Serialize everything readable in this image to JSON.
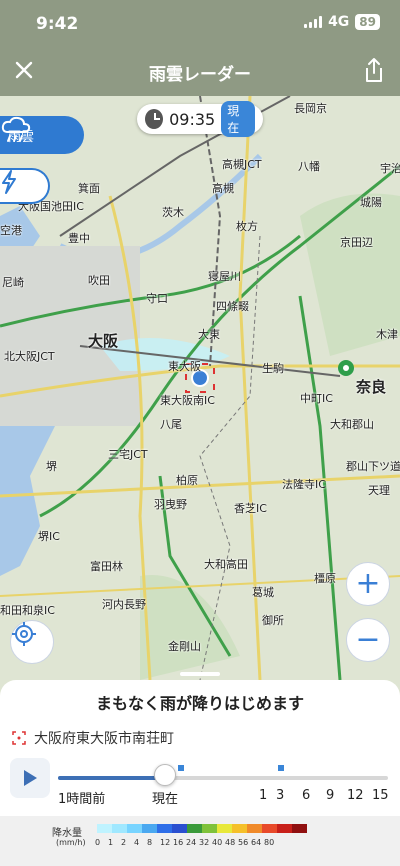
{
  "status": {
    "time": "9:42",
    "network": "4G",
    "battery": "89"
  },
  "nav": {
    "title": "雨雲レーダー",
    "close_icon": "close-icon",
    "share_icon": "share-icon"
  },
  "map": {
    "time_display": "09:35",
    "now_badge": "現在",
    "rain_tab_label": "雨雲",
    "lightning_icon": "lightning-icon",
    "places": [
      {
        "name": "長岡京",
        "big": false
      },
      {
        "name": "宇治",
        "big": false
      },
      {
        "name": "高槻JCT",
        "big": false
      },
      {
        "name": "八幡",
        "big": false
      },
      {
        "name": "城陽",
        "big": false
      },
      {
        "name": "箕面",
        "big": false
      },
      {
        "name": "高槻",
        "big": false
      },
      {
        "name": "大阪国池田IC",
        "big": false
      },
      {
        "name": "茨木",
        "big": false
      },
      {
        "name": "空港",
        "big": false
      },
      {
        "name": "豊中",
        "big": false
      },
      {
        "name": "枚方",
        "big": false
      },
      {
        "name": "京田辺",
        "big": false
      },
      {
        "name": "尼崎",
        "big": false
      },
      {
        "name": "吹田",
        "big": false
      },
      {
        "name": "寝屋川",
        "big": false
      },
      {
        "name": "守口",
        "big": false
      },
      {
        "name": "四條畷",
        "big": false
      },
      {
        "name": "木津",
        "big": false
      },
      {
        "name": "大阪",
        "big": true
      },
      {
        "name": "大東",
        "big": false
      },
      {
        "name": "北大阪JCT",
        "big": false
      },
      {
        "name": "東大阪",
        "big": false
      },
      {
        "name": "生駒",
        "big": false
      },
      {
        "name": "奈良",
        "big": true
      },
      {
        "name": "東大阪南IC",
        "big": false
      },
      {
        "name": "中町IC",
        "big": false
      },
      {
        "name": "八尾",
        "big": false
      },
      {
        "name": "大和郡山",
        "big": false
      },
      {
        "name": "堺",
        "big": false
      },
      {
        "name": "三宅JCT",
        "big": false
      },
      {
        "name": "郡山下ツ道JCT",
        "big": false
      },
      {
        "name": "柏原",
        "big": false
      },
      {
        "name": "法隆寺IC",
        "big": false
      },
      {
        "name": "天理",
        "big": false
      },
      {
        "name": "羽曳野",
        "big": false
      },
      {
        "name": "香芝IC",
        "big": false
      },
      {
        "name": "堺IC",
        "big": false
      },
      {
        "name": "富田林",
        "big": false
      },
      {
        "name": "大和高田",
        "big": false
      },
      {
        "name": "橿原",
        "big": false
      },
      {
        "name": "葛城",
        "big": false
      },
      {
        "name": "和田和泉IC",
        "big": false
      },
      {
        "name": "河内長野",
        "big": false
      },
      {
        "name": "御所",
        "big": false
      },
      {
        "name": "金剛山",
        "big": false
      }
    ],
    "zoom_in": "+",
    "zoom_out": "−"
  },
  "sheet": {
    "headline": "まもなく雨が降りはじめます",
    "location": "大阪府東大阪市南荘町",
    "slider_labels": [
      "1時間前",
      "現在",
      "1",
      "3",
      "6",
      "9",
      "12",
      "15"
    ],
    "slider_position_fraction": 0.33
  },
  "legend": {
    "title": "降水量",
    "unit": "(mm/h)",
    "values": [
      "0",
      "1",
      "2",
      "4",
      "8",
      "12",
      "16",
      "24",
      "32",
      "40",
      "48",
      "56",
      "64",
      "80"
    ],
    "colors": [
      "#bff3ff",
      "#a0e8ff",
      "#78d4ff",
      "#4aa8f0",
      "#2e6ee8",
      "#2a4fd0",
      "#3a9a3a",
      "#7fc23a",
      "#e8e83a",
      "#f5c02a",
      "#f08a2a",
      "#e84a2a",
      "#c8201a",
      "#901010"
    ]
  }
}
